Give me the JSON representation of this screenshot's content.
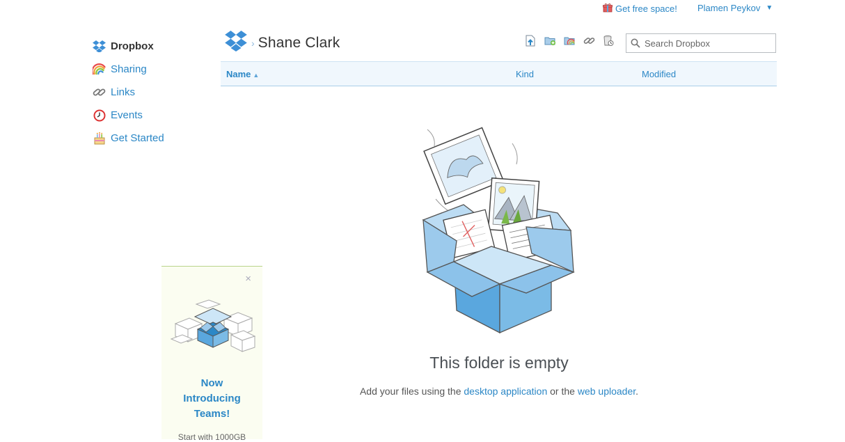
{
  "topbar": {
    "free_space": "Get free space!",
    "user_name": "Plamen Peykov",
    "user_caret": "▼"
  },
  "sidebar": {
    "items": [
      {
        "label": "Dropbox",
        "icon": "dropbox-icon"
      },
      {
        "label": "Sharing",
        "icon": "rainbow-icon"
      },
      {
        "label": "Links",
        "icon": "link-icon"
      },
      {
        "label": "Events",
        "icon": "clock-icon"
      },
      {
        "label": "Get Started",
        "icon": "cake-icon"
      }
    ]
  },
  "header": {
    "separator": "›",
    "title": "Shane Clark",
    "toolbar": [
      {
        "icon": "upload-icon"
      },
      {
        "icon": "new-folder-icon"
      },
      {
        "icon": "shared-folder-icon"
      },
      {
        "icon": "link-icon"
      },
      {
        "icon": "deleted-files-icon"
      }
    ]
  },
  "search": {
    "placeholder": "Search Dropbox"
  },
  "columns": {
    "name": "Name",
    "sort_indicator": "▲",
    "kind": "Kind",
    "modified": "Modified"
  },
  "empty": {
    "title": "This folder is empty",
    "text_before": "Add your files using the ",
    "link_desktop": "desktop application",
    "text_middle": " or the ",
    "link_web": "web uploader",
    "text_after": "."
  },
  "promo": {
    "close": "×",
    "line1": "Now",
    "line2": "Introducing",
    "line3": "Teams!",
    "note": "Start with 1000GB"
  },
  "colors": {
    "link": "#2b87c6",
    "header_bg": "#f0f7fd",
    "promo_bg": "#fbfdf1",
    "box_blue": "#5aa7de"
  }
}
